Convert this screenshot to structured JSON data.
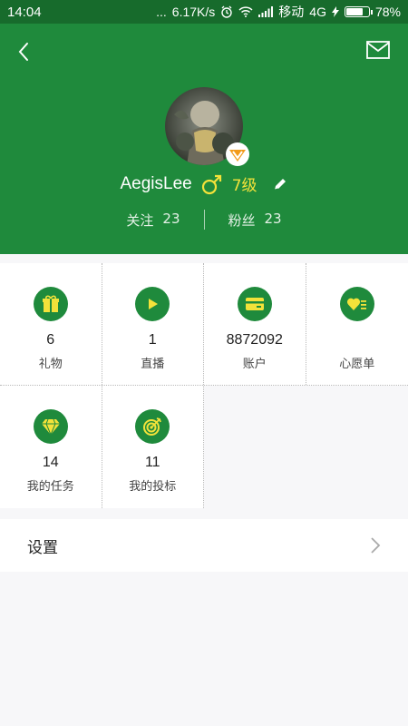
{
  "status_bar": {
    "time": "14:04",
    "dots": "...",
    "speed": "6.17K/s",
    "carrier": "移动",
    "network": "4G",
    "battery": "78%",
    "battery_level": 0.78
  },
  "profile": {
    "name": "AegisLee",
    "gender_symbol": "♂",
    "level": "7级",
    "follow_label": "关注",
    "follow_count": "23",
    "fans_label": "粉丝",
    "fans_count": "23"
  },
  "grid": {
    "items": [
      {
        "count": "6",
        "label": "礼物",
        "icon": "gift-icon"
      },
      {
        "count": "1",
        "label": "直播",
        "icon": "play-icon"
      },
      {
        "count": "8872092",
        "label": "账户",
        "icon": "card-icon"
      },
      {
        "count": "",
        "label": "心愿单",
        "icon": "heart-list-icon"
      },
      {
        "count": "14",
        "label": "我的任务",
        "icon": "diamond-icon"
      },
      {
        "count": "11",
        "label": "我的投标",
        "icon": "target-icon"
      }
    ]
  },
  "settings": {
    "label": "设置"
  },
  "colors": {
    "status_bar": "#176b2c",
    "header": "#1f8a3c",
    "level": "#f3e23a",
    "icon_accent": "#f3e23a"
  }
}
